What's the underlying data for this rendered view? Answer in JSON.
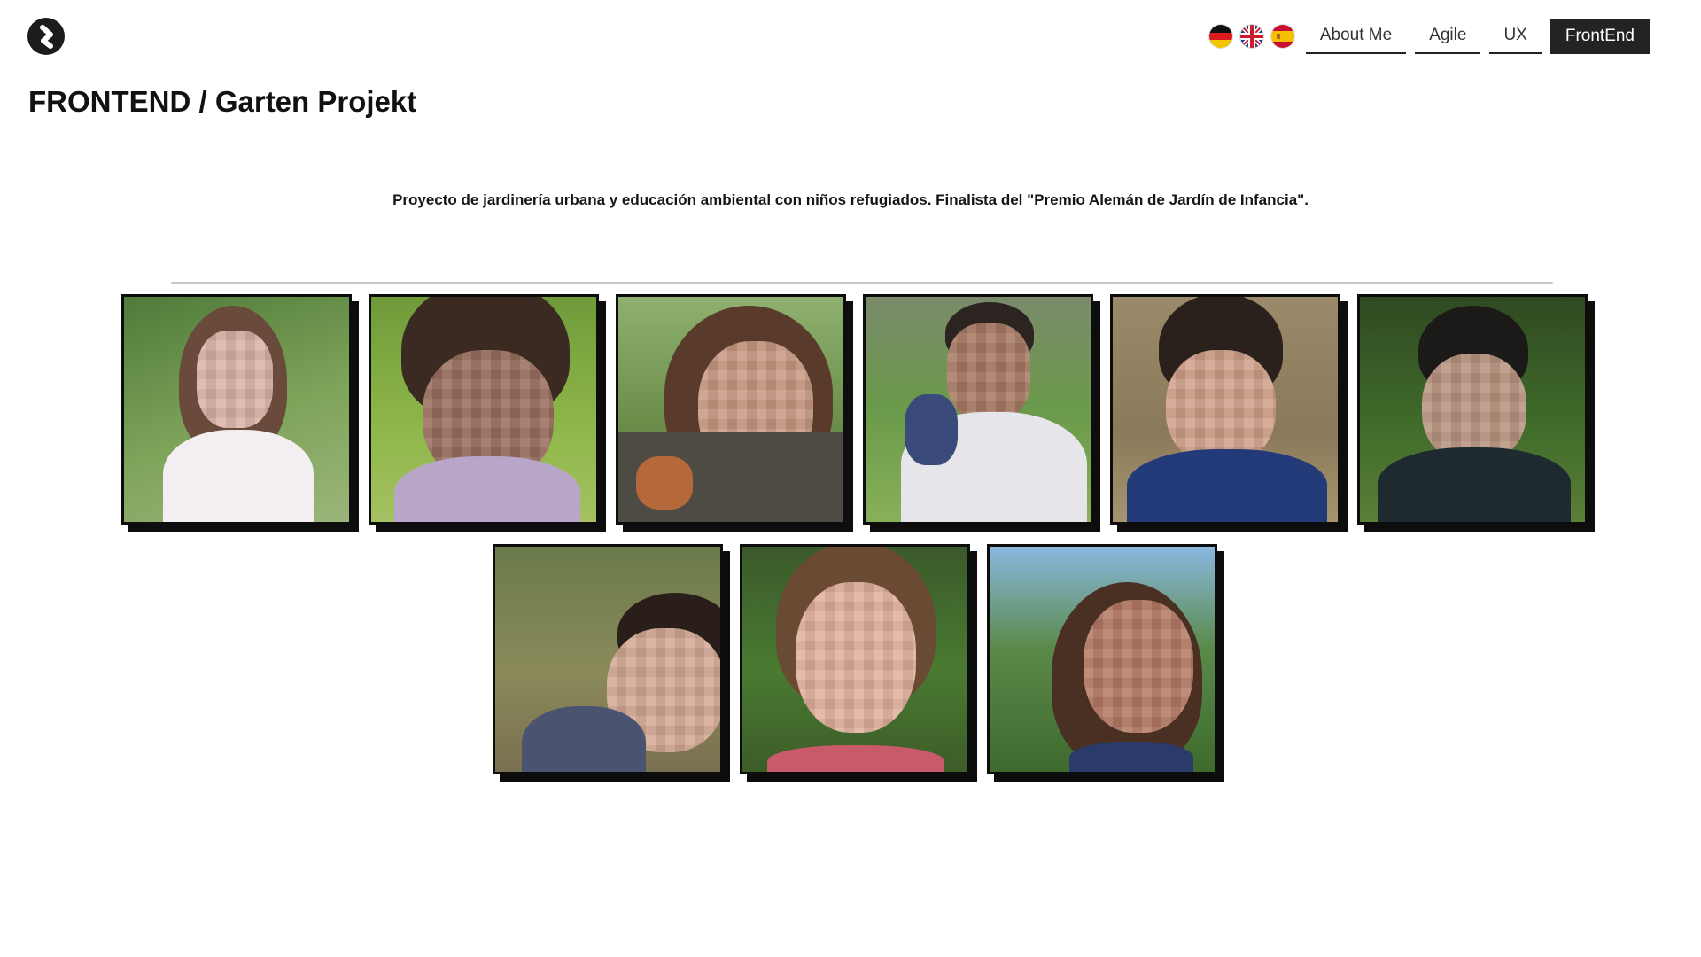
{
  "header": {
    "logo_icon": "logo-s-icon",
    "languages": [
      {
        "code": "de",
        "icon": "flag-germany-icon"
      },
      {
        "code": "en",
        "icon": "flag-uk-icon"
      },
      {
        "code": "es",
        "icon": "flag-spain-icon"
      }
    ],
    "nav": [
      {
        "label": "About Me",
        "active": false
      },
      {
        "label": "Agile",
        "active": false
      },
      {
        "label": "UX",
        "active": false
      },
      {
        "label": "FrontEnd",
        "active": true
      }
    ]
  },
  "main": {
    "title": "FRONTEND / Garten Projekt",
    "description": "Proyecto de jardinería urbana y educación ambiental con niños refugiados. Finalista del \"Premio Alemán de Jardín de Infancia\"."
  },
  "gallery": {
    "photo_count": 9,
    "face_style": "pixelated",
    "colors": {
      "frame": "#0d0d0d",
      "nav_active_bg": "#232323"
    }
  }
}
